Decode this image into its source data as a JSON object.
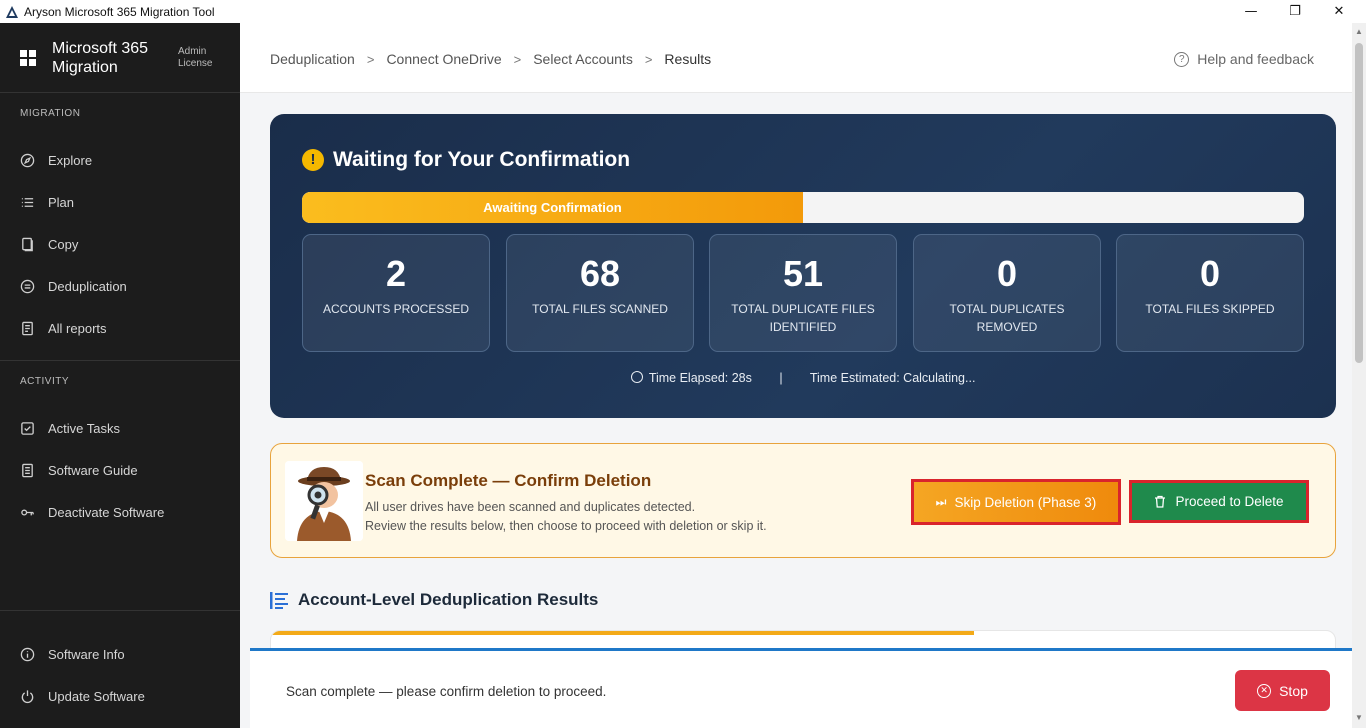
{
  "window": {
    "title": "Aryson Microsoft 365 Migration Tool",
    "controls": {
      "minimize": "—",
      "maximize": "❐",
      "close": "✕"
    }
  },
  "sidebar": {
    "brand": {
      "name": "Microsoft 365 Migration",
      "license": "Admin License"
    },
    "sections": [
      {
        "label": "MIGRATION",
        "items": [
          {
            "label": "Explore",
            "icon": "compass-icon"
          },
          {
            "label": "Plan",
            "icon": "list-icon"
          },
          {
            "label": "Copy",
            "icon": "copy-icon"
          },
          {
            "label": "Deduplication",
            "icon": "dedup-icon"
          },
          {
            "label": "All reports",
            "icon": "report-icon"
          }
        ]
      },
      {
        "label": "ACTIVITY",
        "items": [
          {
            "label": "Active Tasks",
            "icon": "checkbox-icon"
          },
          {
            "label": "Software Guide",
            "icon": "document-icon"
          },
          {
            "label": "Deactivate Software",
            "icon": "key-icon"
          }
        ]
      }
    ],
    "footer_items": [
      {
        "label": "Software Info",
        "icon": "info-icon"
      },
      {
        "label": "Update Software",
        "icon": "power-icon"
      }
    ]
  },
  "header": {
    "breadcrumb": [
      "Deduplication",
      "Connect OneDrive",
      "Select Accounts",
      "Results"
    ],
    "separator": ">",
    "help": "Help and feedback"
  },
  "status": {
    "title": "Waiting for Your Confirmation",
    "progress_label": "Awaiting Confirmation",
    "progress_fraction": 0.5,
    "stats": [
      {
        "value": "2",
        "label": "ACCOUNTS PROCESSED"
      },
      {
        "value": "68",
        "label": "TOTAL FILES SCANNED"
      },
      {
        "value": "51",
        "label": "TOTAL DUPLICATE FILES IDENTIFIED"
      },
      {
        "value": "0",
        "label": "TOTAL DUPLICATES REMOVED"
      },
      {
        "value": "0",
        "label": "TOTAL FILES SKIPPED"
      }
    ],
    "time_elapsed": "Time Elapsed: 28s",
    "time_separator": "|",
    "time_estimated": "Time Estimated: Calculating..."
  },
  "confirm": {
    "title": "Scan Complete — Confirm Deletion",
    "line1": "All user drives have been scanned and duplicates detected.",
    "line2": "Review the results below, then choose to proceed with deletion or skip it.",
    "skip_label": "Skip Deletion (Phase 3)",
    "proceed_label": "Proceed to Delete"
  },
  "results": {
    "title": "Account-Level Deduplication Results"
  },
  "footer": {
    "message": "Scan complete — please confirm deletion to proceed.",
    "stop_label": "Stop"
  },
  "colors": {
    "accent_orange": "#f39a0a",
    "navy": "#1a2d4a",
    "green": "#1f8a4c",
    "red": "#dc3545",
    "blue": "#1f78c8"
  }
}
